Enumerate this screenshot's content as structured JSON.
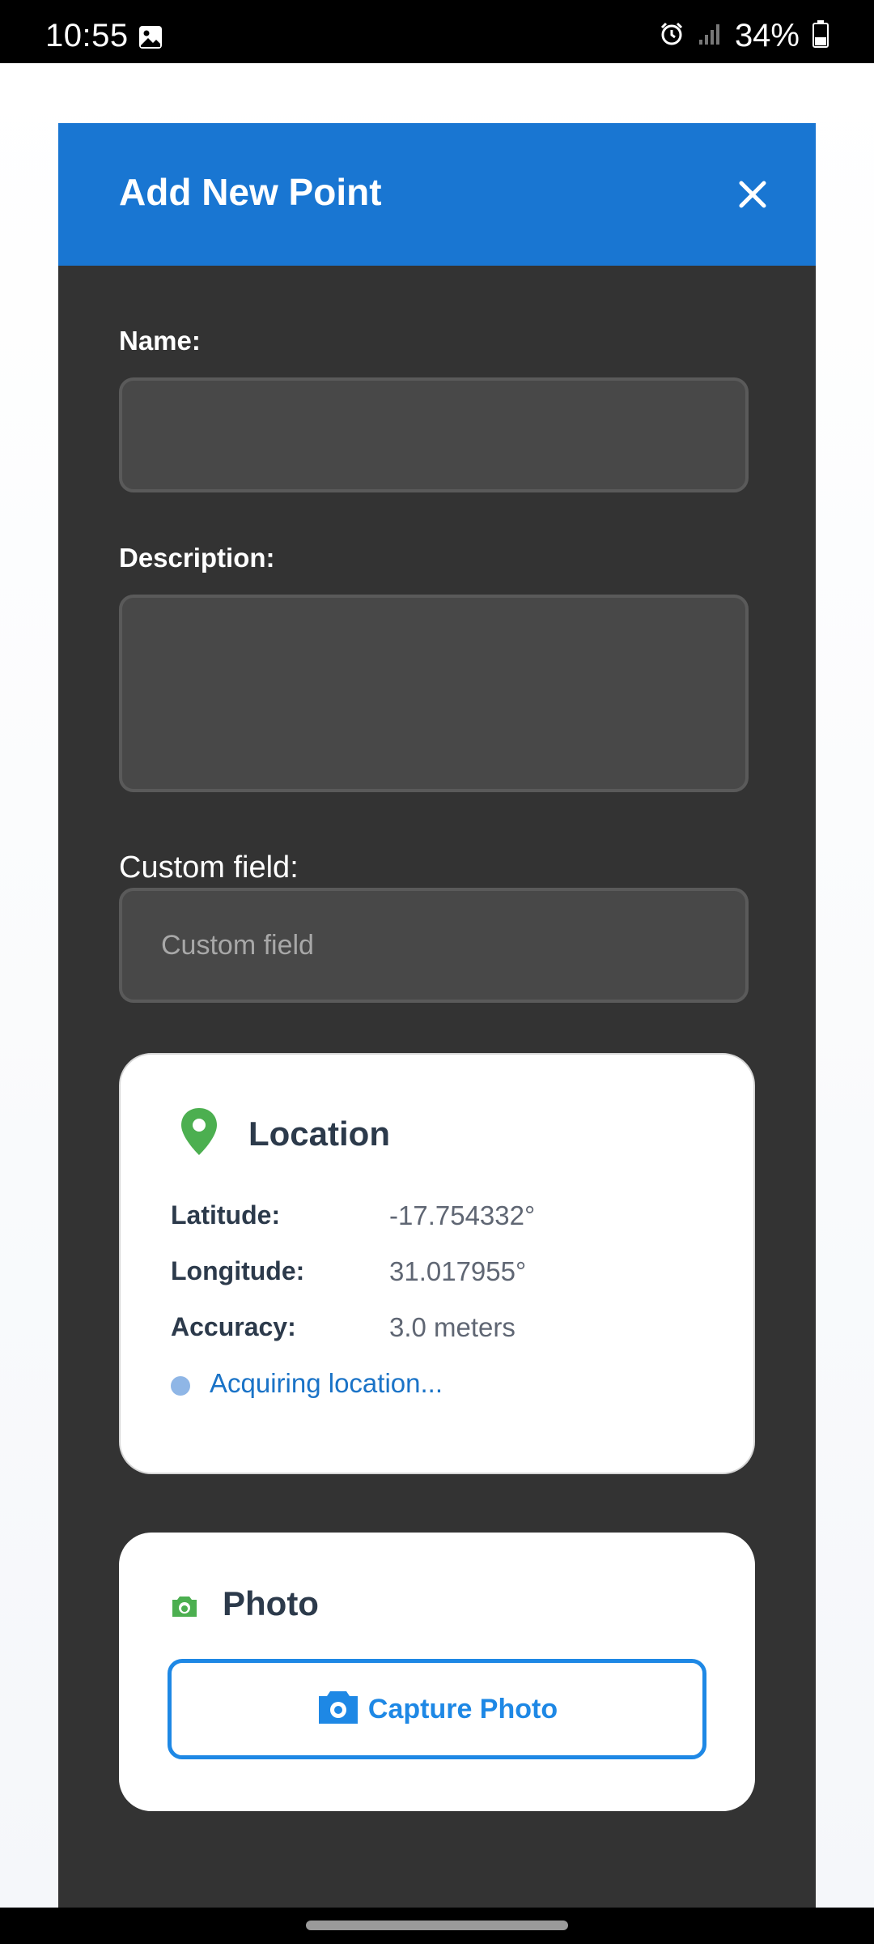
{
  "status_bar": {
    "time": "10:55",
    "battery_text": "34%",
    "icons": [
      "gallery-icon",
      "alarm-icon",
      "signal-icon",
      "battery-icon"
    ]
  },
  "modal": {
    "title": "Add New Point",
    "close_icon": "close-icon",
    "fields": {
      "name_label": "Name:",
      "name_value": "",
      "description_label": "Description:",
      "description_value": "",
      "custom_label": "Custom field:",
      "custom_placeholder": "Custom field",
      "custom_value": ""
    },
    "location": {
      "title": "Location",
      "icon": "map-pin-icon",
      "latitude_label": "Latitude:",
      "latitude_value": "-17.754332°",
      "longitude_label": "Longitude:",
      "longitude_value": "31.017955°",
      "accuracy_label": "Accuracy:",
      "accuracy_value": "3.0 meters",
      "status_text": "Acquiring location..."
    },
    "photo": {
      "title": "Photo",
      "icon": "camera-icon",
      "capture_label": "Capture Photo"
    }
  },
  "colors": {
    "header": "#1976d2",
    "modal_bg": "#333333",
    "input_bg": "#484848",
    "accent": "#1e88e5",
    "pin": "#4caf50"
  }
}
